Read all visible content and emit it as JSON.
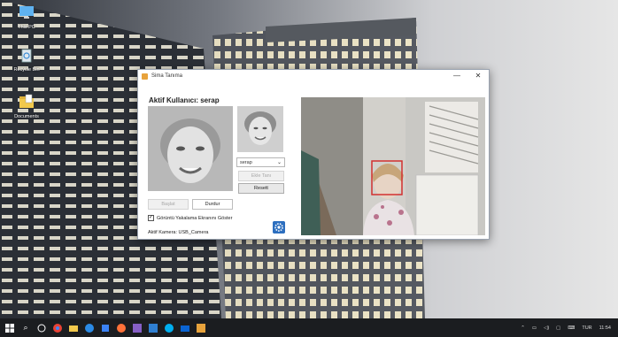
{
  "desktop": {
    "icons": [
      {
        "label": "This PC",
        "icon": "computer-icon"
      },
      {
        "label": "Recycle Bin",
        "icon": "recycle-bin-icon"
      },
      {
        "label": "Documents",
        "icon": "folder-icon"
      }
    ]
  },
  "window": {
    "title": "Sima Tanıma",
    "minimize_glyph": "—",
    "close_glyph": "✕"
  },
  "panel": {
    "active_user_label": "Aktif Kullanıcı: serap",
    "user_select_value": "serap",
    "train_button": "Ekle Tanı",
    "reset_button": "Resett",
    "start_button": "Başlat",
    "stop_button": "Durdur",
    "checkbox_label": "Görüntü Yakalama Ekranını Göster",
    "checkbox_checked": true,
    "active_camera_text": "Aktif Kamera: USB_Camera"
  },
  "taskbar": {
    "search_glyph": "⌕",
    "tray_lang": "TUR",
    "tray_time": "11:54"
  },
  "colors": {
    "accent": "#2d6fbf",
    "detect_box": "#d23030"
  }
}
